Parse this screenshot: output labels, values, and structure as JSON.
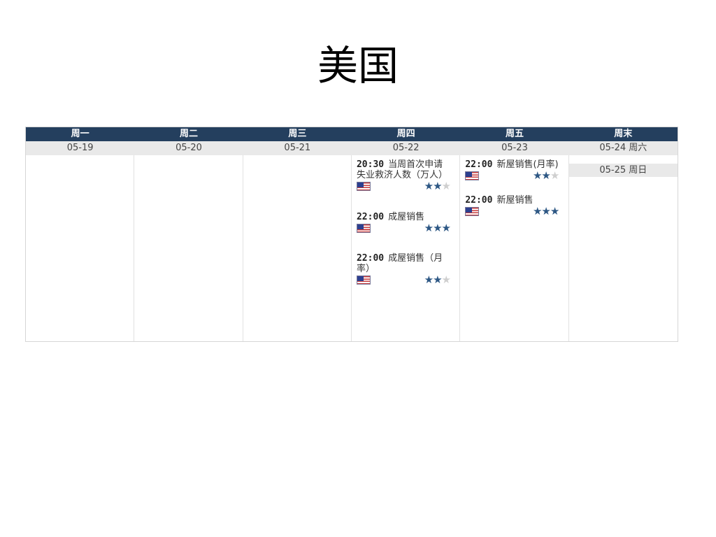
{
  "title": "美国",
  "calendar": {
    "header": [
      "周一",
      "周二",
      "周三",
      "周四",
      "周五",
      "周末"
    ],
    "dates": [
      "05-19",
      "05-20",
      "05-21",
      "05-22",
      "05-23",
      "05-24 周六"
    ],
    "sunday_date": "05-25 周日",
    "days": [
      {
        "events": []
      },
      {
        "events": []
      },
      {
        "events": []
      },
      {
        "events": [
          {
            "time": "20:30",
            "name": "当周首次申请失业救济人数（万人）",
            "flag": "us-flag-icon",
            "importance": 2,
            "max": 3
          },
          {
            "time": "22:00",
            "name": "成屋销售",
            "flag": "us-flag-icon",
            "importance": 3,
            "max": 3
          },
          {
            "time": "22:00",
            "name": "成屋销售（月率）",
            "flag": "us-flag-icon",
            "importance": 2,
            "max": 3
          }
        ]
      },
      {
        "events": [
          {
            "time": "22:00",
            "name": "新屋销售(月率)",
            "flag": "us-flag-icon",
            "importance": 2,
            "max": 3
          },
          {
            "time": "22:00",
            "name": "新屋销售",
            "flag": "us-flag-icon",
            "importance": 3,
            "max": 3
          }
        ]
      },
      {
        "events": []
      }
    ]
  },
  "colors": {
    "header_bg": "#243f5e",
    "date_bg": "#e9e9e9",
    "star_on": "#2d5784",
    "star_off": "#cfcfcf"
  }
}
